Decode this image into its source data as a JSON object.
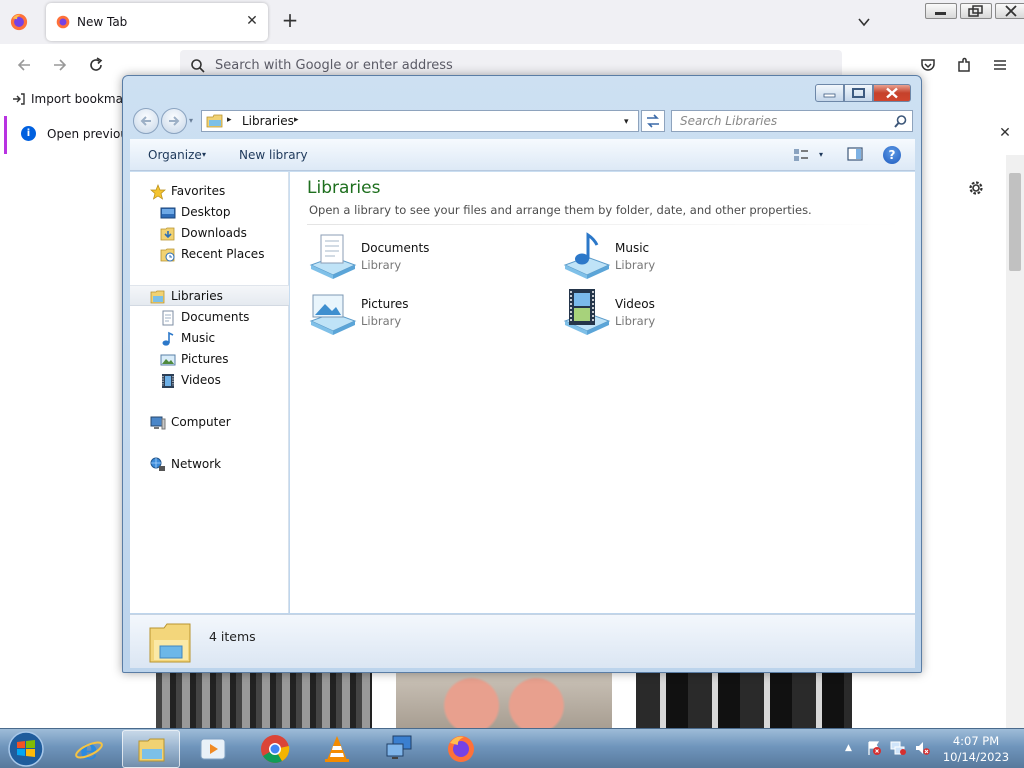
{
  "browser": {
    "tab_title": "New Tab",
    "new_tab_label": "+",
    "url_placeholder": "Search with Google or enter address",
    "bookmark_import_label": "Import bookmarks…",
    "notification_text": "Open previous tabs?",
    "close_glyph": "✕"
  },
  "explorer": {
    "address": {
      "separator": "▸",
      "crumb": "Libraries",
      "dropdown_glyph": "▾"
    },
    "search_placeholder": "Search Libraries",
    "commands": {
      "organize": "Organize",
      "new_library": "New library",
      "arrow": "▾",
      "help": "?"
    },
    "nav": {
      "favorites": "Favorites",
      "desktop": "Desktop",
      "downloads": "Downloads",
      "recent_places": "Recent Places",
      "libraries": "Libraries",
      "documents": "Documents",
      "music": "Music",
      "pictures": "Pictures",
      "videos": "Videos",
      "computer": "Computer",
      "network": "Network"
    },
    "content": {
      "title": "Libraries",
      "subtitle": "Open a library to see your files and arrange them by folder, date, and other properties.",
      "items": [
        {
          "name": "Documents",
          "type": "Library",
          "icon": "documents-library-icon"
        },
        {
          "name": "Music",
          "type": "Library",
          "icon": "music-library-icon"
        },
        {
          "name": "Pictures",
          "type": "Library",
          "icon": "pictures-library-icon"
        },
        {
          "name": "Videos",
          "type": "Library",
          "icon": "videos-library-icon"
        }
      ]
    },
    "status": {
      "item_count": "4 items"
    }
  },
  "taskbar": {
    "apps": [
      "internet-explorer",
      "windows-explorer",
      "windows-media-center",
      "google-chrome",
      "vlc-media-player",
      "remote-desktop",
      "firefox"
    ],
    "active_app": "windows-explorer",
    "time": "4:07 PM",
    "date": "10/14/2023"
  }
}
